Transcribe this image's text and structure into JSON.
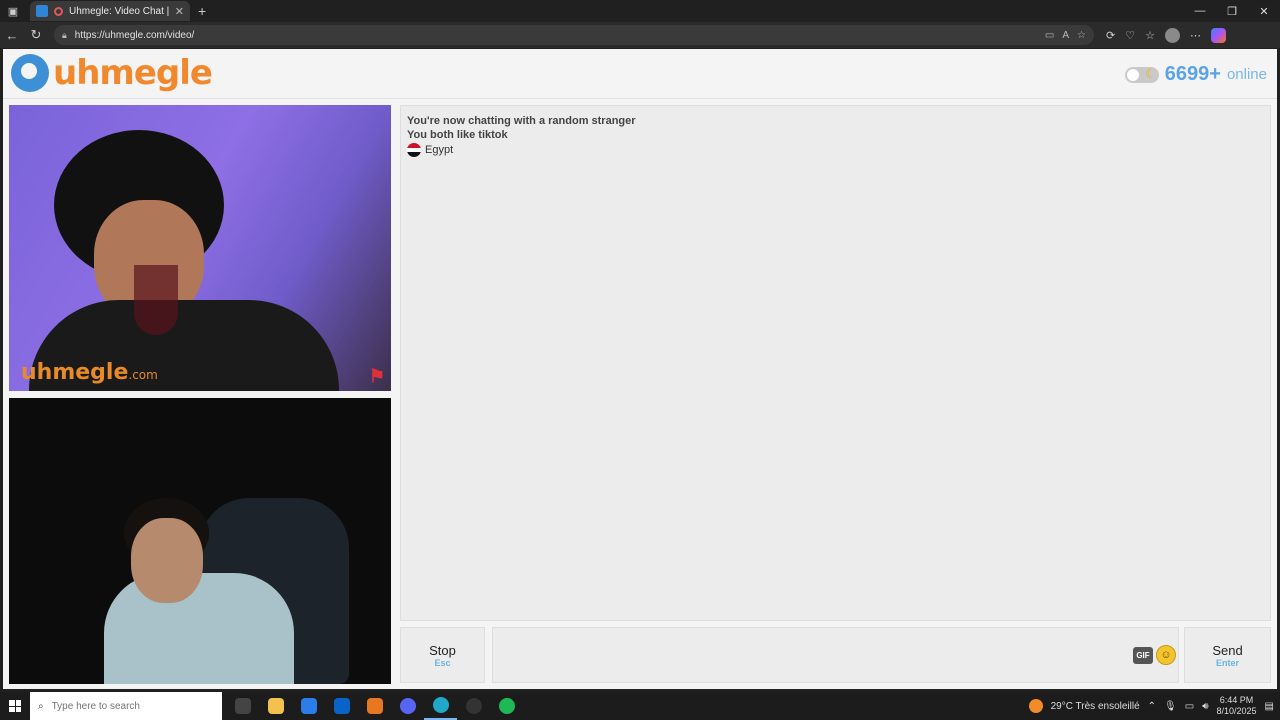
{
  "browser": {
    "tab_title": "Uhmegle: Video Chat | Ome",
    "new_tab_symbol": "+",
    "url": "https://uhmegle.com/video/",
    "window_controls": [
      "minimize",
      "restore",
      "close"
    ]
  },
  "header": {
    "logo_text": "uhmegle",
    "online_count": "6699+",
    "online_label": "online"
  },
  "stranger_video": {
    "watermark": "uhmegle",
    "watermark_suffix": ".com"
  },
  "chat": {
    "messages": [
      "You're now chatting with a random stranger",
      "You both like tiktok"
    ],
    "country": "Egypt",
    "flag_colors": [
      "#ce1126",
      "#ffffff",
      "#111111"
    ]
  },
  "controls": {
    "stop_label": "Stop",
    "stop_hint": "Esc",
    "message_placeholder": "",
    "gif_label": "GIF",
    "send_label": "Send",
    "send_hint": "Enter"
  },
  "taskbar": {
    "search_placeholder": "Type here to search",
    "weather": "29°C  Très ensoleillé",
    "time": "6:44 PM",
    "date": "8/10/2025",
    "apps": [
      {
        "name": "task-view",
        "color": "#444444"
      },
      {
        "name": "file-explorer",
        "color": "#f2c14e"
      },
      {
        "name": "microsoft-store",
        "color": "#2b7de9"
      },
      {
        "name": "outlook",
        "color": "#0a64c8"
      },
      {
        "name": "matlab",
        "color": "#e87722"
      },
      {
        "name": "discord-overlay",
        "color": "#5865f2"
      },
      {
        "name": "edge",
        "color": "#1fa8c9"
      },
      {
        "name": "obs",
        "color": "#333333"
      },
      {
        "name": "spotify",
        "color": "#1db954"
      }
    ]
  },
  "colors": {
    "brand_orange": "#f0892e",
    "brand_blue": "#3d8fd6",
    "online_blue": "#5aa4e6"
  }
}
